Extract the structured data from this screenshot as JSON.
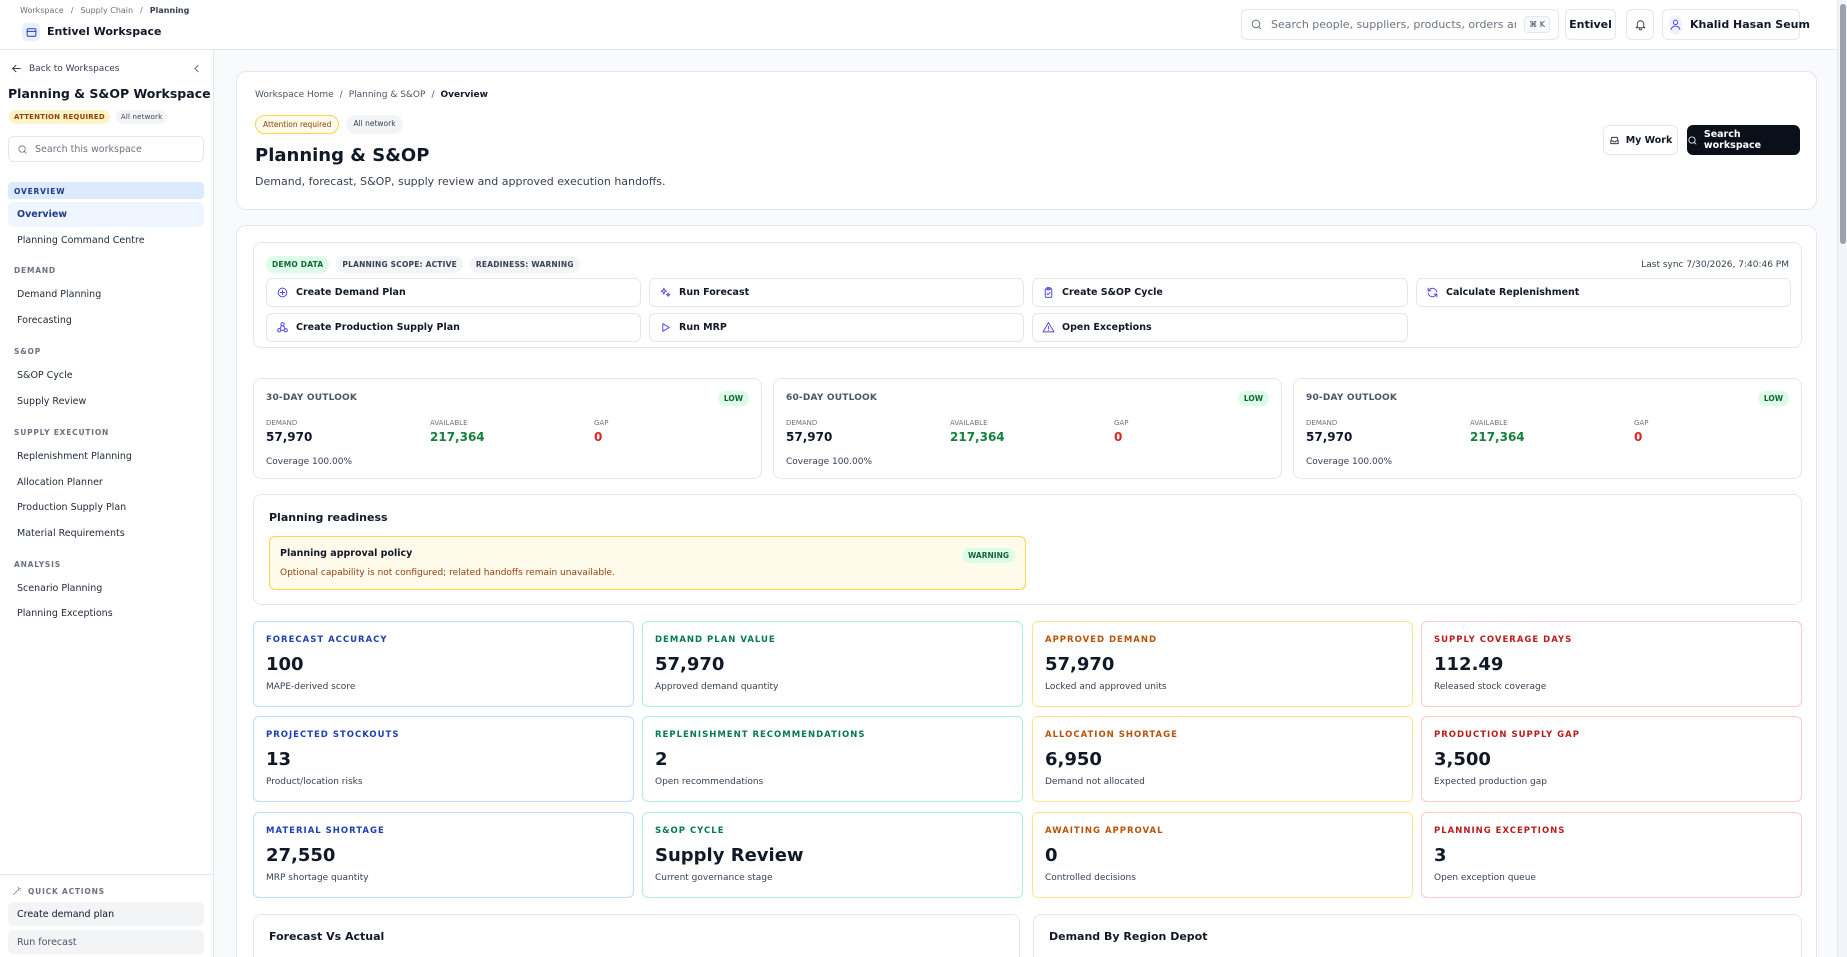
{
  "topbar": {
    "breadcrumb": [
      "Workspace",
      "Supply Chain",
      "Planning"
    ],
    "workspace_name": "Entivel Workspace",
    "search_placeholder": "Search people, suppliers, products, orders and ...",
    "shortcut": "⌘ K",
    "brand_button": "Entivel",
    "user_name": "Khalid Hasan Seum"
  },
  "sidebar": {
    "back_label": "Back to Workspaces",
    "title": "Planning & S&OP Workspace",
    "badges": [
      "ATTENTION REQUIRED",
      "All network"
    ],
    "search_placeholder": "Search this workspace",
    "sections": [
      {
        "label": "OVERVIEW",
        "items": [
          "Overview",
          "Planning Command Centre"
        ]
      },
      {
        "label": "DEMAND",
        "items": [
          "Demand Planning",
          "Forecasting"
        ]
      },
      {
        "label": "S&OP",
        "items": [
          "S&OP Cycle",
          "Supply Review"
        ]
      },
      {
        "label": "SUPPLY EXECUTION",
        "items": [
          "Replenishment Planning",
          "Allocation Planner",
          "Production Supply Plan",
          "Material Requirements"
        ]
      },
      {
        "label": "ANALYSIS",
        "items": [
          "Scenario Planning",
          "Planning Exceptions"
        ]
      }
    ],
    "quick_actions_label": "QUICK ACTIONS",
    "quick_actions": [
      "Create demand plan",
      "Run forecast"
    ]
  },
  "header": {
    "breadcrumb": [
      "Workspace Home",
      "Planning & S&OP",
      "Overview"
    ],
    "badges": [
      "Attention required",
      "All network"
    ],
    "title": "Planning & S&OP",
    "subtitle": "Demand, forecast, S&OP, supply review and approved execution handoffs.",
    "my_work": "My Work",
    "search_workspace": "Search workspace"
  },
  "actions_panel": {
    "badges": [
      "DEMO DATA",
      "PLANNING SCOPE: ACTIVE",
      "READINESS: WARNING"
    ],
    "last_sync": "Last sync 7/30/2026, 7:40:46 PM",
    "buttons": [
      {
        "label": "Create Demand Plan",
        "icon": "plus-circle-icon"
      },
      {
        "label": "Run Forecast",
        "icon": "sparkles-icon"
      },
      {
        "label": "Create S&OP Cycle",
        "icon": "clipboard-icon"
      },
      {
        "label": "Calculate Replenishment",
        "icon": "refresh-icon"
      },
      {
        "label": "Create Production Supply Plan",
        "icon": "network-icon"
      },
      {
        "label": "Run MRP",
        "icon": "play-icon"
      },
      {
        "label": "Open Exceptions",
        "icon": "warning-icon"
      }
    ]
  },
  "outlooks": [
    {
      "title": "30-DAY OUTLOOK",
      "badge": "LOW",
      "demand_label": "DEMAND",
      "demand": "57,970",
      "available_label": "AVAILABLE",
      "available": "217,364",
      "gap_label": "GAP",
      "gap": "0",
      "coverage": "Coverage 100.00%"
    },
    {
      "title": "60-DAY OUTLOOK",
      "badge": "LOW",
      "demand_label": "DEMAND",
      "demand": "57,970",
      "available_label": "AVAILABLE",
      "available": "217,364",
      "gap_label": "GAP",
      "gap": "0",
      "coverage": "Coverage 100.00%"
    },
    {
      "title": "90-DAY OUTLOOK",
      "badge": "LOW",
      "demand_label": "DEMAND",
      "demand": "57,970",
      "available_label": "AVAILABLE",
      "available": "217,364",
      "gap_label": "GAP",
      "gap": "0",
      "coverage": "Coverage 100.00%"
    }
  ],
  "readiness": {
    "title": "Planning readiness",
    "policy_title": "Planning approval policy",
    "policy_text": "Optional capability is not configured; related handoffs remain unavailable.",
    "policy_badge": "WARNING"
  },
  "kpis": [
    {
      "label": "FORECAST ACCURACY",
      "value": "100",
      "sub": "MAPE-derived score",
      "tone": "blue"
    },
    {
      "label": "DEMAND PLAN VALUE",
      "value": "57,970",
      "sub": "Approved demand quantity",
      "tone": "green"
    },
    {
      "label": "APPROVED DEMAND",
      "value": "57,970",
      "sub": "Locked and approved units",
      "tone": "amber"
    },
    {
      "label": "SUPPLY COVERAGE DAYS",
      "value": "112.49",
      "sub": "Released stock coverage",
      "tone": "red"
    },
    {
      "label": "PROJECTED STOCKOUTS",
      "value": "13",
      "sub": "Product/location risks",
      "tone": "blue"
    },
    {
      "label": "REPLENISHMENT RECOMMENDATIONS",
      "value": "2",
      "sub": "Open recommendations",
      "tone": "green"
    },
    {
      "label": "ALLOCATION SHORTAGE",
      "value": "6,950",
      "sub": "Demand not allocated",
      "tone": "amber"
    },
    {
      "label": "PRODUCTION SUPPLY GAP",
      "value": "3,500",
      "sub": "Expected production gap",
      "tone": "red"
    },
    {
      "label": "MATERIAL SHORTAGE",
      "value": "27,550",
      "sub": "MRP shortage quantity",
      "tone": "blue"
    },
    {
      "label": "S&OP CYCLE",
      "value": "Supply Review",
      "sub": "Current governance stage",
      "tone": "green"
    },
    {
      "label": "AWAITING APPROVAL",
      "value": "0",
      "sub": "Controlled decisions",
      "tone": "amber"
    },
    {
      "label": "PLANNING EXCEPTIONS",
      "value": "3",
      "sub": "Open exception queue",
      "tone": "red"
    }
  ],
  "charts": [
    "Forecast Vs Actual",
    "Demand By Region Depot"
  ],
  "colors": {
    "accent": "#4f46e5",
    "positive": "#15803d",
    "negative": "#dc2626",
    "primary_button": "#0b0f19"
  }
}
